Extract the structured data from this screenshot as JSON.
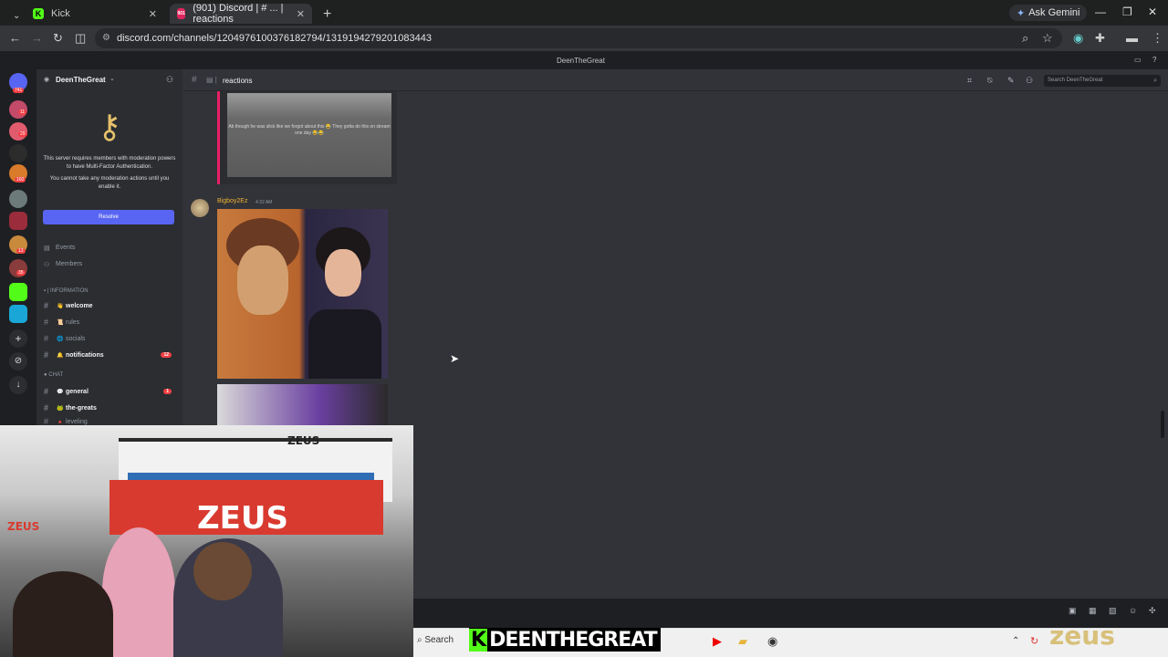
{
  "browser": {
    "tabs": [
      {
        "label": "Kick",
        "favicon_text": "K",
        "favicon_color": "#53fc18"
      },
      {
        "label": "(901) Discord | # ... | reactions",
        "favicon_text": "901",
        "favicon_color": "#e0245e"
      }
    ],
    "new_tab": "+",
    "ask_gemini": "Ask Gemini",
    "url": "discord.com/channels/1204976100376182794/1319194279201083443"
  },
  "discord": {
    "window_title": "DeenTheGreat",
    "server_name": "DeenTheGreat",
    "server_badges": [
      "741",
      "11",
      "29",
      "160",
      "13",
      "35"
    ],
    "mfa_notice": "This server requires members with moderation powers to have Multi-Factor Authentication.",
    "mfa_sub": "You cannot take any moderation actions until you enable it.",
    "resolve_label": "Resolve",
    "events_label": "Events",
    "members_label": "Members",
    "categories": {
      "information": "INFORMATION",
      "chat": "CHAT"
    },
    "channels": [
      {
        "emoji": "👋",
        "name": "welcome",
        "unread": true,
        "count": ""
      },
      {
        "emoji": "📜",
        "name": "rules",
        "unread": false,
        "count": ""
      },
      {
        "emoji": "🌐",
        "name": "socials",
        "unread": false,
        "count": ""
      },
      {
        "emoji": "🔔",
        "name": "notifications",
        "unread": true,
        "count": "12"
      },
      {
        "emoji": "💬",
        "name": "general",
        "unread": true,
        "count": "1"
      },
      {
        "emoji": "🐸",
        "name": "the-greats",
        "unread": true,
        "count": ""
      },
      {
        "emoji": "🔺",
        "name": "leveling",
        "unread": false,
        "count": ""
      }
    ],
    "header": {
      "channel": "reactions",
      "search_placeholder": "Search DeenTheGreat"
    },
    "embed_caption": "Ab though he was slick like we forgot about this 😂 They gotta do this on stream one day 😂😂",
    "message": {
      "author": "Bigboy2Ez",
      "time": "4:32 AM"
    }
  },
  "overlay": {
    "streamer_name": "DEENTHEGREAT",
    "kick_letter": "K",
    "brand": "ZEUS"
  },
  "taskbar": {
    "search": "Search"
  }
}
